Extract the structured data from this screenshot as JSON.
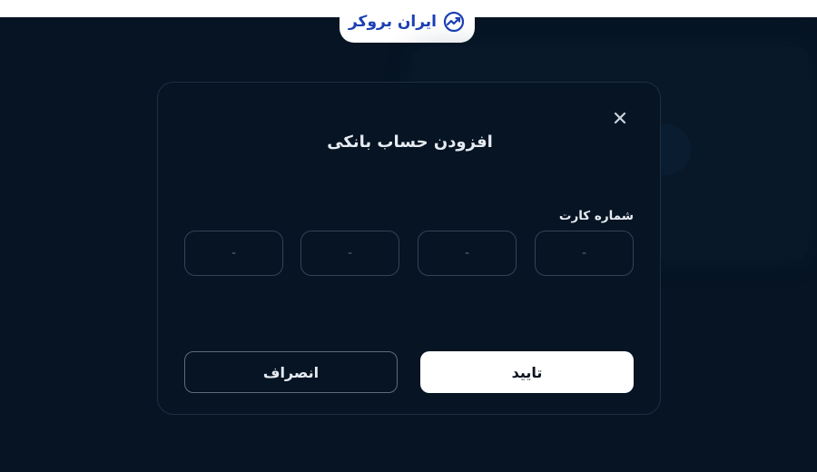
{
  "header": {
    "logo_text": "ایران بروکر",
    "logo_icon": "trend-chart-icon",
    "brand_color": "#1c3fb3"
  },
  "modal": {
    "title": "افزودن حساب بانکی",
    "close_icon": "close-icon",
    "card_number_label": "شماره کارت",
    "card_segments": [
      {
        "placeholder": "-"
      },
      {
        "placeholder": "-"
      },
      {
        "placeholder": "-"
      },
      {
        "placeholder": "-"
      }
    ],
    "confirm_label": "تایید",
    "cancel_label": "انصراف"
  },
  "colors": {
    "background": "#061423",
    "confirm_bg": "#ffffff",
    "border": "#344456"
  }
}
